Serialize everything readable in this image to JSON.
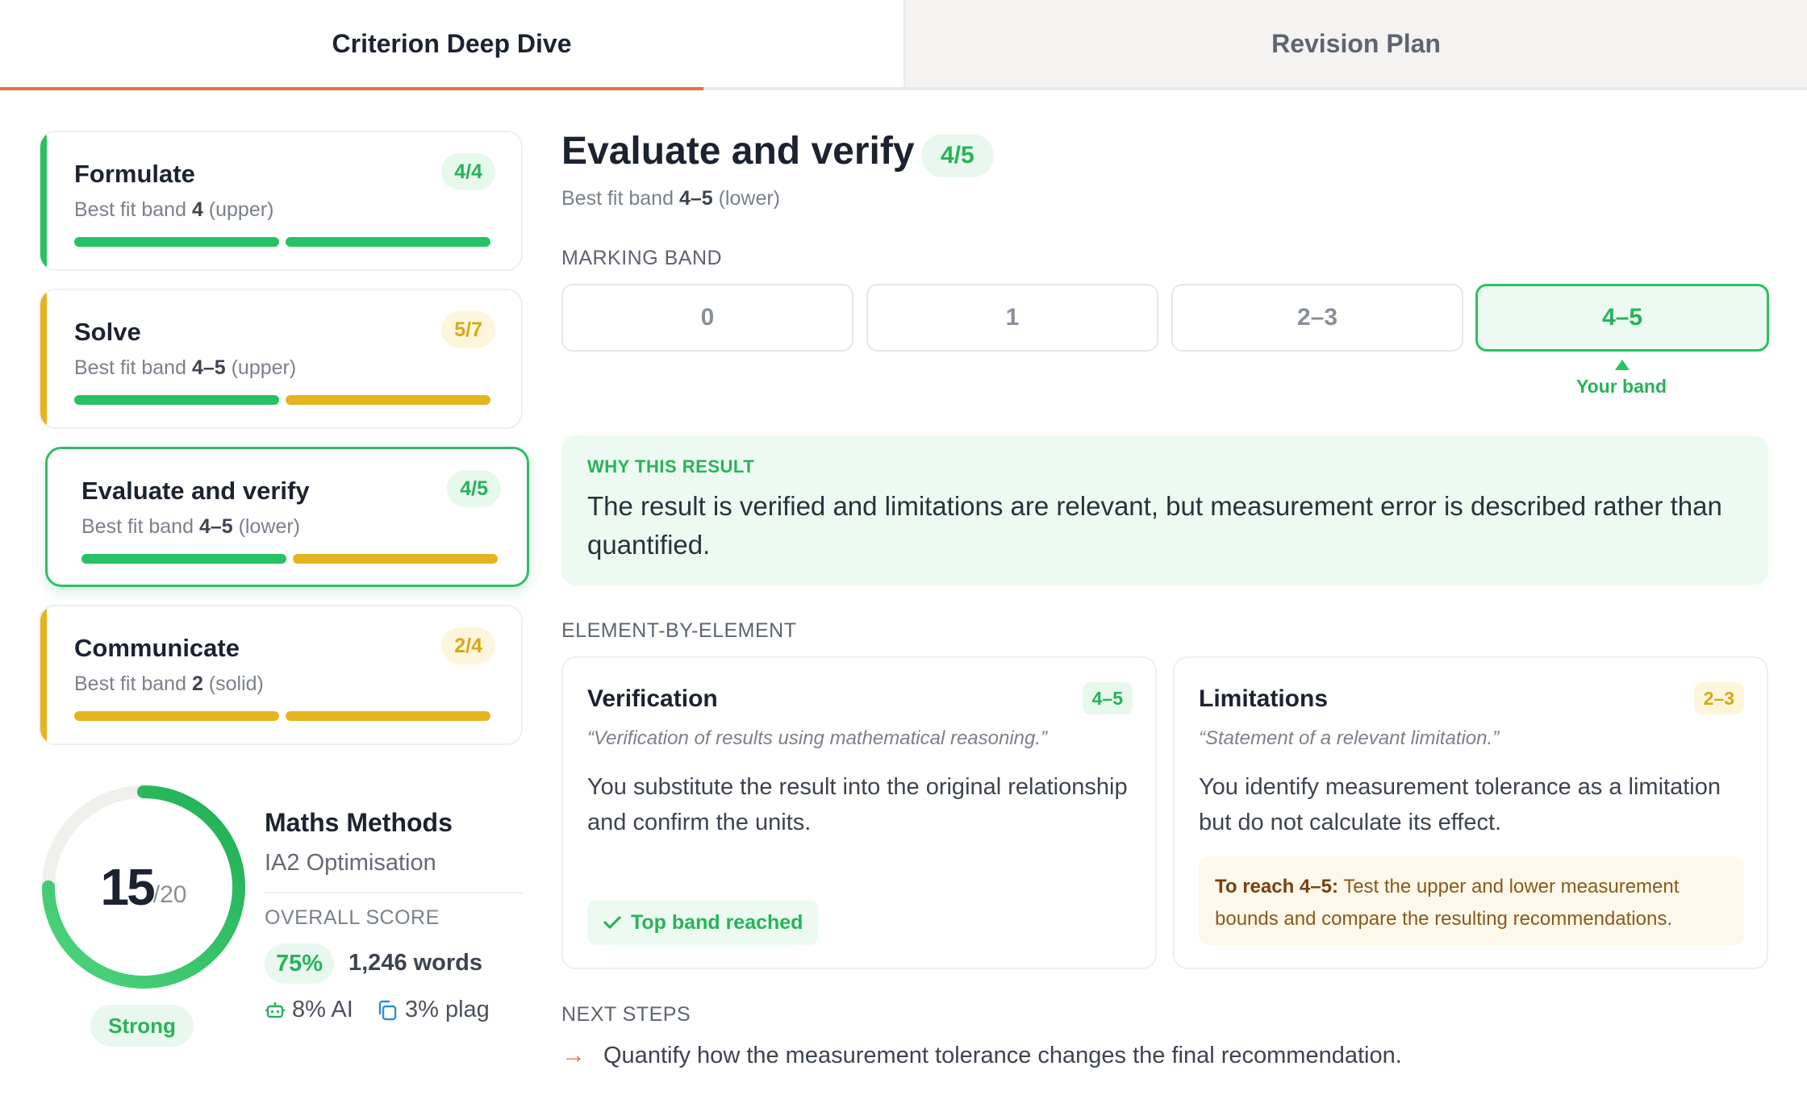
{
  "tabs": {
    "active": "Criterion Deep Dive",
    "inactive": "Revision Plan"
  },
  "criteria": [
    {
      "title": "Formulate",
      "score": "4/4",
      "band_prefix": "Best fit band",
      "band": "4",
      "band_suffix": "(upper)",
      "status": "green",
      "bar_fill": [
        "green",
        "green"
      ]
    },
    {
      "title": "Solve",
      "score": "5/7",
      "band_prefix": "Best fit band",
      "band": "4–5",
      "band_suffix": "(upper)",
      "status": "amber",
      "bar_fill": [
        "green",
        "amber"
      ]
    },
    {
      "title": "Evaluate and verify",
      "score": "4/5",
      "band_prefix": "Best fit band",
      "band": "4–5",
      "band_suffix": "(lower)",
      "status": "green",
      "bar_fill": [
        "green",
        "amber"
      ],
      "selected": true
    },
    {
      "title": "Communicate",
      "score": "2/4",
      "band_prefix": "Best fit band",
      "band": "2",
      "band_suffix": "(solid)",
      "status": "amber",
      "bar_fill": [
        "amber",
        "amber"
      ]
    }
  ],
  "overall": {
    "score": "15",
    "total": "/20",
    "fraction": 0.75,
    "rating": "Strong",
    "subject": "Maths Methods",
    "task": "IA2 Optimisation",
    "label": "OVERALL SCORE",
    "percent": "75%",
    "words": "1,246 words",
    "ai": "8% AI",
    "plag": "3% plag"
  },
  "detail": {
    "title": "Evaluate and verify",
    "score": "4/5",
    "band_prefix": "Best fit band",
    "band": "4–5",
    "band_suffix": "(lower)",
    "marking_label": "MARKING BAND",
    "bands": [
      "0",
      "1",
      "2–3",
      "4–5"
    ],
    "active_band": "4–5",
    "your_band": "Your band",
    "why_label": "WHY THIS RESULT",
    "why_text": "The result is verified and limitations are relevant, but measurement error is described rather than quantified.",
    "elements_label": "ELEMENT-BY-ELEMENT",
    "elements": [
      {
        "title": "Verification",
        "score": "4–5",
        "quote": "“Verification of results using mathematical reasoning.”",
        "body": "You substitute the result into the original relationship and confirm the units.",
        "reached": "Top band reached"
      },
      {
        "title": "Limitations",
        "score": "2–3",
        "quote": "“Statement of a relevant limitation.”",
        "body": "You identify measurement tolerance as a limitation but do not calculate its effect.",
        "reach_label": "To reach 4–5:",
        "reach_text": "Test the upper and lower measurement bounds and compare the resulting recommendations."
      }
    ],
    "next_label": "NEXT STEPS",
    "next_steps": [
      "Quantify how the measurement tolerance changes the final recommendation."
    ]
  },
  "colors": {
    "accent": "#ee6b43",
    "green": "#26c263",
    "amber": "#e6b41e",
    "text": "#1c2230"
  }
}
